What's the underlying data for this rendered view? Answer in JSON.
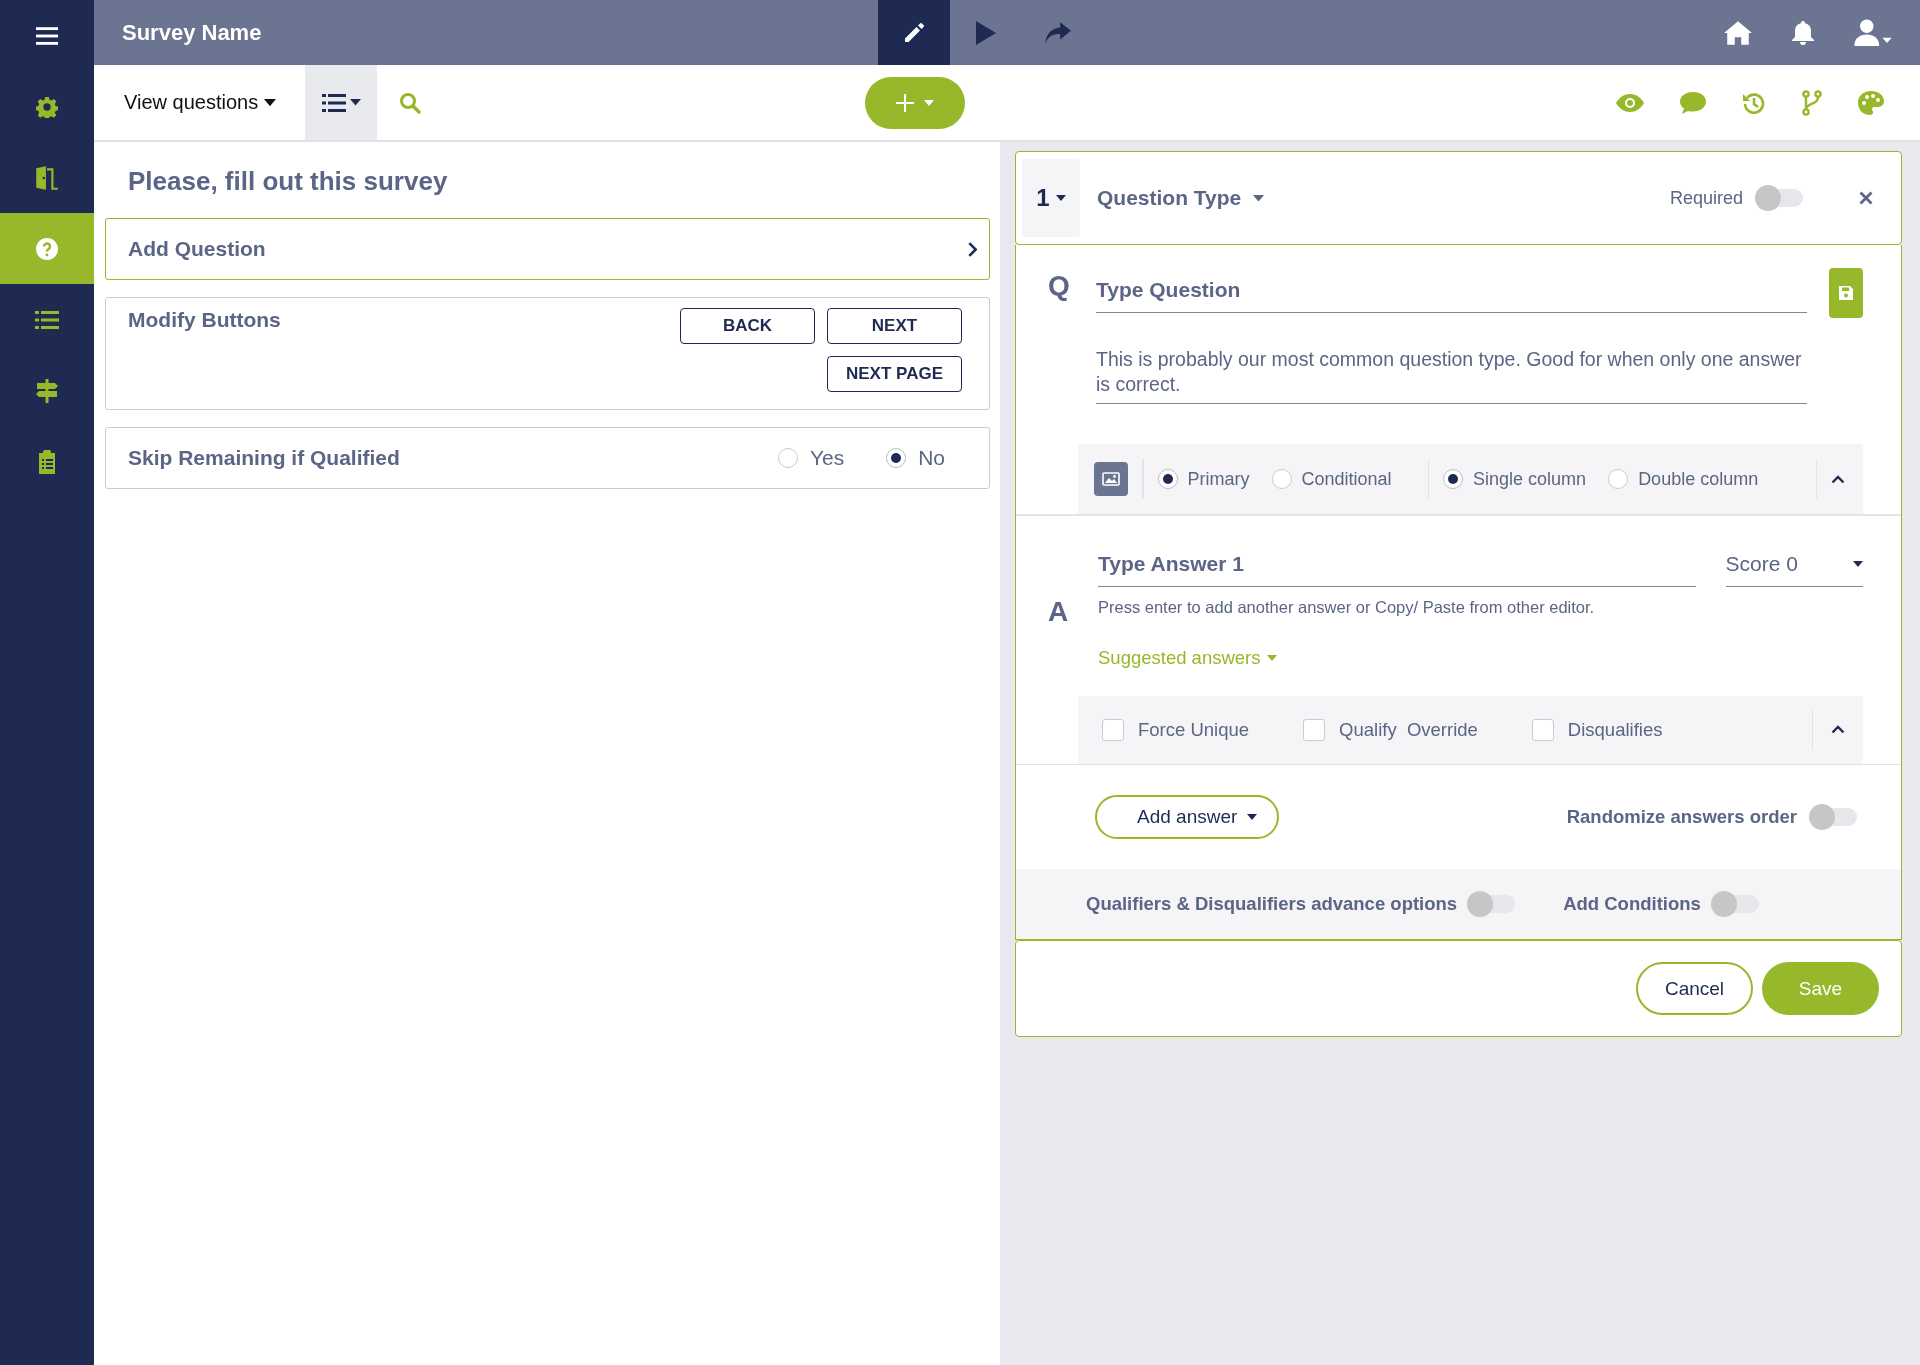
{
  "sidebar": {
    "items": [
      {
        "kind": "menu",
        "selected": false
      },
      {
        "kind": "settings",
        "selected": false
      },
      {
        "kind": "exit",
        "selected": false
      },
      {
        "kind": "question",
        "selected": true
      },
      {
        "kind": "list",
        "selected": false
      },
      {
        "kind": "signpost",
        "selected": false
      },
      {
        "kind": "clipboard",
        "selected": false
      }
    ]
  },
  "topbar": {
    "title": "Survey Name",
    "tools": [
      {
        "kind": "edit",
        "selected": true
      },
      {
        "kind": "play",
        "selected": false
      },
      {
        "kind": "share",
        "selected": false
      }
    ]
  },
  "toolbar": {
    "view_menu": "View questions",
    "list_view": {
      "selected": true
    },
    "actions": [
      {
        "kind": "preview"
      },
      {
        "kind": "comments"
      },
      {
        "kind": "history"
      },
      {
        "kind": "branch"
      },
      {
        "kind": "theme"
      }
    ]
  },
  "survey": {
    "title": "Please, fill out this survey",
    "add_question": "Add Question",
    "modify_buttons": {
      "label": "Modify Buttons",
      "buttons": [
        "BACK",
        "NEXT",
        "NEXT PAGE"
      ]
    },
    "skip": {
      "label": "Skip Remaining if Qualified",
      "options": [
        {
          "label": "Yes",
          "selected": false
        },
        {
          "label": "No",
          "selected": true
        }
      ]
    }
  },
  "question": {
    "number": "1",
    "type": "Question Type",
    "required": {
      "label": "Required",
      "on": false
    },
    "q_marker": "Q",
    "question_field": {
      "placeholder": "Type Question"
    },
    "description": "This is probably our most common question type. Good for when only one answer is correct.",
    "role_options": [
      {
        "label": "Primary",
        "selected": true
      },
      {
        "label": "Conditional",
        "selected": false
      }
    ],
    "column_options": [
      {
        "label": "Single column",
        "selected": true
      },
      {
        "label": "Double column",
        "selected": false
      }
    ],
    "a_marker": "A",
    "answer_field": {
      "placeholder": "Type Answer 1"
    },
    "score": "Score 0",
    "answer_hint": "Press enter to add another answer or Copy/ Paste from other editor.",
    "suggested": "Suggested answers",
    "answer_options": [
      {
        "label": "Force Unique",
        "checked": false
      },
      {
        "label": "Qualify  Override",
        "checked": false
      },
      {
        "label": "Disqualifies",
        "checked": false
      }
    ],
    "add_answer": "Add answer",
    "randomize": {
      "label": "Randomize answers order",
      "on": false
    },
    "advanced": [
      {
        "label": "Qualifiers & Disqualifiers advance options",
        "on": false
      },
      {
        "label": "Add Conditions",
        "on": false
      }
    ],
    "cancel": "Cancel",
    "save": "Save"
  }
}
